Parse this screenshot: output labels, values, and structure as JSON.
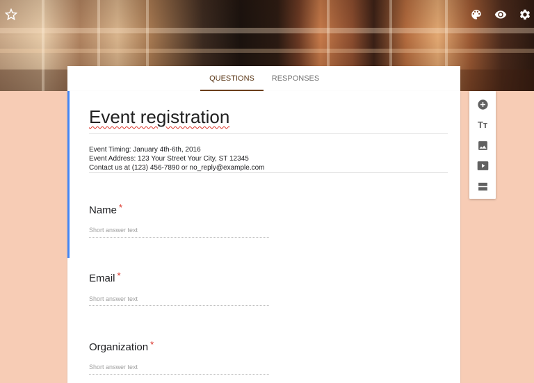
{
  "header": {
    "star_icon": "star-outline-icon",
    "actions": [
      "palette-icon",
      "eye-icon",
      "gear-icon"
    ]
  },
  "tabs": [
    {
      "label": "QUESTIONS",
      "active": true
    },
    {
      "label": "RESPONSES",
      "active": false
    }
  ],
  "form": {
    "title": "Event registration",
    "description": [
      "Event Timing: January 4th-6th, 2016",
      "Event Address: 123 Your Street Your City, ST 12345",
      "Contact us at (123) 456-7890 or no_reply@example.com"
    ],
    "questions": [
      {
        "label": "Name",
        "required_mark": "*",
        "placeholder": "Short answer text"
      },
      {
        "label": "Email",
        "required_mark": "*",
        "placeholder": "Short answer text"
      },
      {
        "label": "Organization",
        "required_mark": "*",
        "placeholder": "Short answer text"
      }
    ]
  },
  "toolbar": {
    "tools": [
      "add-question-icon",
      "add-title-icon",
      "add-image-icon",
      "add-video-icon",
      "add-section-icon"
    ],
    "title_glyph": "Tт"
  },
  "colors": {
    "page_background": "#f7ccb5",
    "accent": "#6b3f1c",
    "active_bar": "#4285f4",
    "required": "#d93025"
  }
}
